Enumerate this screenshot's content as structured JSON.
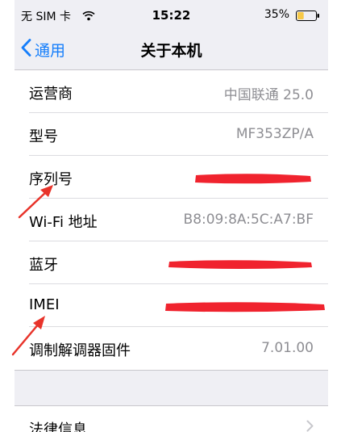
{
  "status_bar": {
    "carrier": "无 SIM 卡",
    "time": "15:22",
    "battery_percent": "35%",
    "battery_level": 0.35,
    "battery_color": "#f7c948"
  },
  "nav": {
    "back_label": "通用",
    "title": "关于本机",
    "accent_color": "#157efb"
  },
  "rows": [
    {
      "label": "运营商",
      "value": "中国联通 25.0"
    },
    {
      "label": "型号",
      "value": "MF353ZP/A"
    },
    {
      "label": "序列号",
      "value": ""
    },
    {
      "label": "Wi-Fi 地址",
      "value": "B8:09:8A:5C:A7:BF"
    },
    {
      "label": "蓝牙",
      "value": ""
    },
    {
      "label": "IMEI",
      "value": ""
    },
    {
      "label": "调制解调器固件",
      "value": "7.01.00"
    }
  ],
  "legal": {
    "label": "法律信息"
  },
  "icons": [
    "wifi-icon",
    "battery-icon",
    "chevron-left-icon",
    "chevron-right-icon",
    "arrow-icon"
  ],
  "redaction_color": "#f0232e",
  "arrow_color": "#e8332a"
}
